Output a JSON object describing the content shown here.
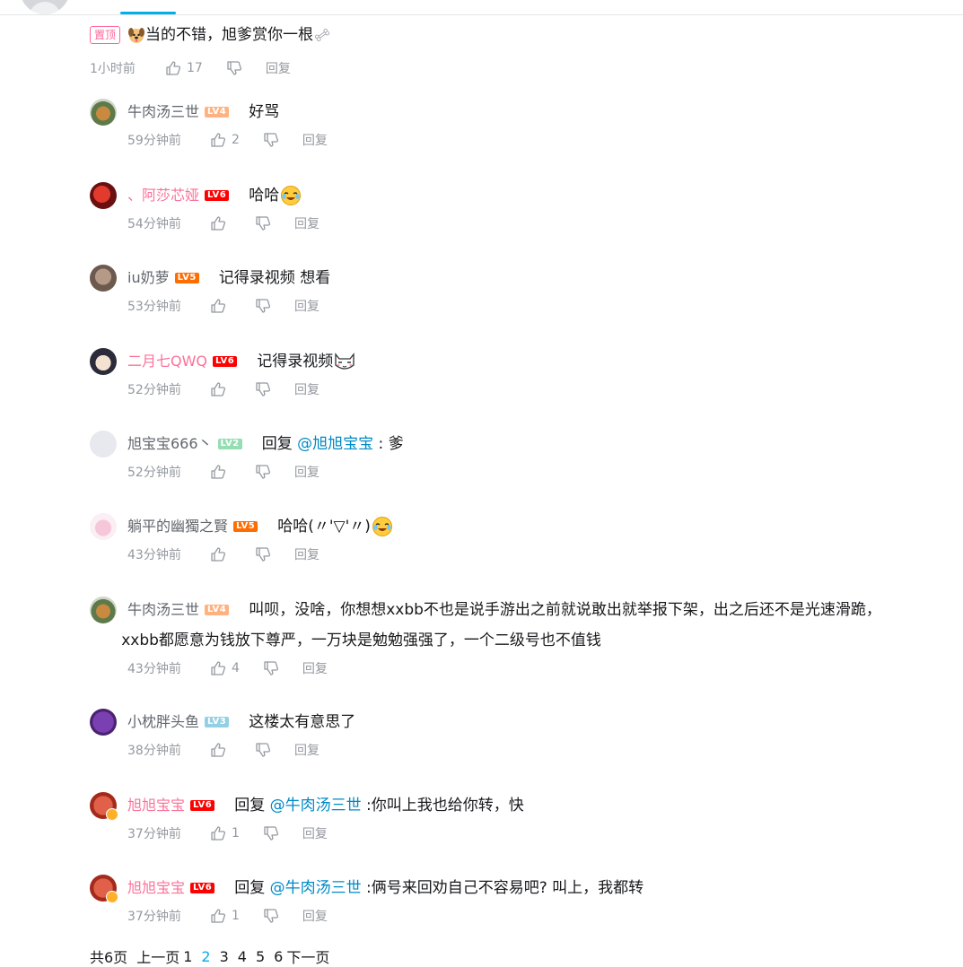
{
  "root": {
    "top_tag": "置顶",
    "text": "当的不错，旭爹赏你一根",
    "time": "1小时前",
    "likes": "17",
    "reply_label": "回复"
  },
  "replies": [
    {
      "user": "牛肉汤三世",
      "level": "LV4",
      "prefix": "",
      "at": "",
      "text": "好骂",
      "time": "59分钟前",
      "likes": "2",
      "reply_label": "回复"
    },
    {
      "user": "、阿莎芯娅",
      "level": "LV6",
      "prefix": "",
      "at": "",
      "text": "哈哈",
      "time": "54分钟前",
      "likes": "",
      "reply_label": "回复"
    },
    {
      "user": "iu奶萝",
      "level": "LV5",
      "prefix": "",
      "at": "",
      "text": "记得录视频 想看",
      "time": "53分钟前",
      "likes": "",
      "reply_label": "回复"
    },
    {
      "user": "二月七QWQ",
      "level": "LV6",
      "prefix": "",
      "at": "",
      "text": "记得录视频",
      "time": "52分钟前",
      "likes": "",
      "reply_label": "回复"
    },
    {
      "user": "旭宝宝666丶",
      "level": "LV2",
      "prefix": "回复 ",
      "at": "@旭旭宝宝",
      "text": " : 爹",
      "time": "52分钟前",
      "likes": "",
      "reply_label": "回复"
    },
    {
      "user": "躺平的幽獨之賢",
      "level": "LV5",
      "prefix": "",
      "at": "",
      "text": "哈哈(〃'▽'〃)",
      "time": "43分钟前",
      "likes": "",
      "reply_label": "回复"
    },
    {
      "user": "牛肉汤三世",
      "level": "LV4",
      "prefix": "",
      "at": "",
      "text": "叫呗，没啥，你想想xxbb不也是说手游出之前就说敢出就举报下架，出之后还不是光速滑跪，",
      "text2": "xxbb都愿意为钱放下尊严，一万块是勉勉强强了，一个二级号也不值钱",
      "time": "43分钟前",
      "likes": "4",
      "reply_label": "回复"
    },
    {
      "user": "小枕胖头鱼",
      "level": "LV3",
      "prefix": "",
      "at": "",
      "text": "这楼太有意思了",
      "time": "38分钟前",
      "likes": "",
      "reply_label": "回复"
    },
    {
      "user": "旭旭宝宝",
      "level": "LV6",
      "prefix": "回复 ",
      "at": "@牛肉汤三世",
      "text": " :你叫上我也给你转，快",
      "time": "37分钟前",
      "likes": "1",
      "reply_label": "回复"
    },
    {
      "user": "旭旭宝宝",
      "level": "LV6",
      "prefix": "回复 ",
      "at": "@牛肉汤三世",
      "text": " :俩号来回劝自己不容易吧? 叫上，我都转",
      "time": "37分钟前",
      "likes": "1",
      "reply_label": "回复"
    }
  ],
  "pager": {
    "total": "共6页",
    "prev": "上一页",
    "pages": [
      "1",
      "2",
      "3",
      "4",
      "5",
      "6"
    ],
    "current": "2",
    "next": "下一页"
  },
  "colors": {
    "accent": "#00aeec",
    "link": "#008ac5",
    "pink_name": "#fb7299",
    "meta": "#9499a0"
  }
}
